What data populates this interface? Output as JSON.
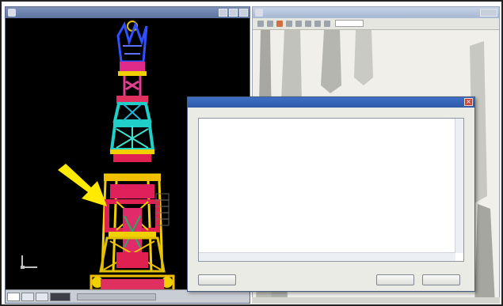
{
  "cad_window": {
    "title": "",
    "icon": "autocad-icon",
    "tabs": [
      "",
      "",
      "",
      ""
    ],
    "ucs_icon": "ucs-axes-icon",
    "colors": {
      "background": "#000000",
      "tower_yellow": "#f0d000",
      "tower_red": "#e01040",
      "tower_cyan": "#20d0c8",
      "tower_blue": "#2040e0",
      "tower_magenta": "#e040c0"
    }
  },
  "viewer_window": {
    "title": "",
    "toolbar_icons": [
      "back-icon",
      "forward-icon",
      "zoom-icon",
      "rotate-icon",
      "print-icon"
    ]
  },
  "dialog": {
    "title": "",
    "lines": [
      "",
      "",
      "",
      "",
      "",
      ""
    ],
    "buttons": {
      "left": "",
      "ok": "",
      "cancel": ""
    }
  },
  "annotation": {
    "arrow": "yellow-arrow-icon",
    "color": "#ffea00"
  }
}
